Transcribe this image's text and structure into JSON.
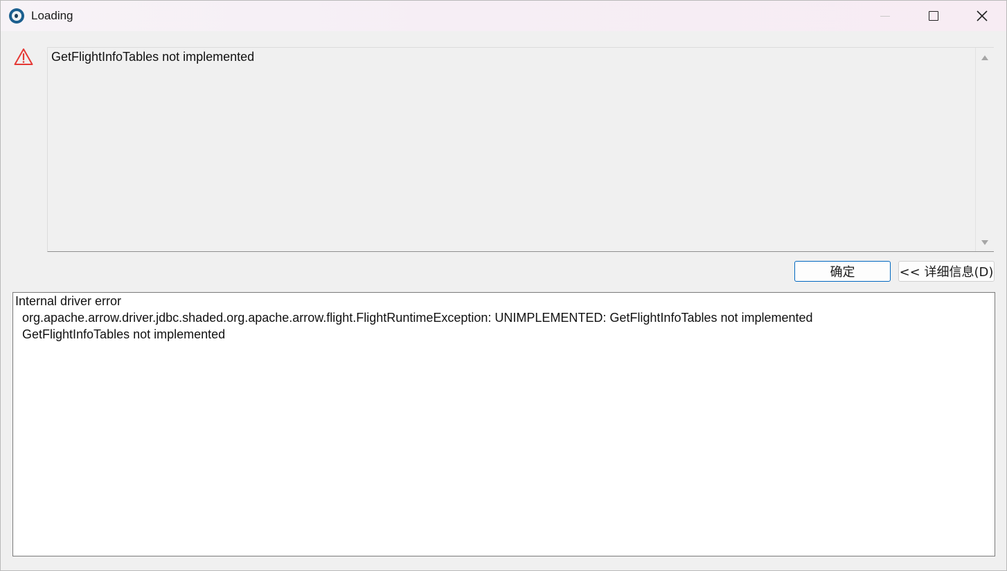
{
  "window": {
    "title": "Loading",
    "controls": {
      "minimize": "minimize",
      "maximize": "maximize",
      "close": "close"
    }
  },
  "message": {
    "icon": "warning-icon",
    "text": "GetFlightInfoTables not implemented"
  },
  "buttons": {
    "ok_label": "确定",
    "details_label": "<< 详细信息(D)"
  },
  "details": {
    "lines": [
      "Internal driver error",
      "  org.apache.arrow.driver.jdbc.shaded.org.apache.arrow.flight.FlightRuntimeException: UNIMPLEMENTED: GetFlightInfoTables not implemented",
      "  GetFlightInfoTables not implemented"
    ]
  },
  "colors": {
    "accent": "#0067c0",
    "warning": "#e53935"
  }
}
